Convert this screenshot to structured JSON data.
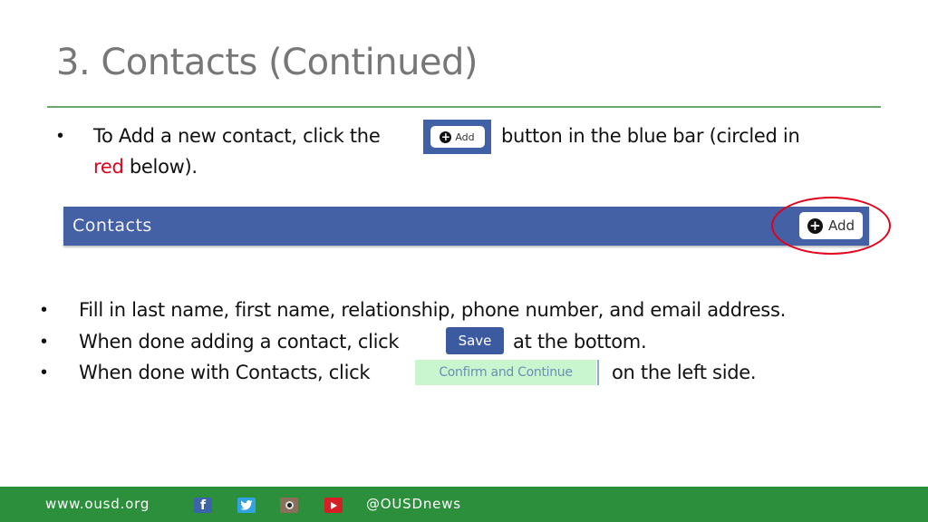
{
  "slide": {
    "title": "3. Contacts (Continued)"
  },
  "intro": {
    "bullet": "•",
    "text_before": "To Add a new contact, click the",
    "text_after": "button in the blue bar (circled in",
    "line2_red": "red",
    "line2_rest": " below)."
  },
  "add_button": {
    "icon": "plus-circle-icon",
    "plus_glyph": "+",
    "label": "Add"
  },
  "contacts_bar": {
    "title": "Contacts",
    "add_label": "Add",
    "plus_glyph": "+"
  },
  "steps": [
    {
      "bullet": "•",
      "text": "Fill in last name, first name, relationship, phone number, and email address."
    },
    {
      "bullet": "•",
      "text_before": "When done adding a contact, click",
      "button": "Save",
      "text_after": "at the bottom."
    },
    {
      "bullet": "•",
      "text_before": "When done with Contacts, click",
      "button": "Confirm and Continue",
      "text_after": "on the left side."
    }
  ],
  "footer": {
    "url": "www.ousd.org",
    "handle": "@OUSDnews",
    "social": [
      {
        "name": "facebook-icon",
        "glyph": "f"
      },
      {
        "name": "twitter-icon",
        "glyph": "t"
      },
      {
        "name": "instagram-icon",
        "glyph": ""
      },
      {
        "name": "youtube-icon",
        "glyph": ""
      }
    ]
  },
  "colors": {
    "accent_blue": "#4461a5",
    "highlight_red": "#e3001b",
    "footer_green": "#2b8f3c",
    "confirm_green": "#c9f5cf"
  }
}
